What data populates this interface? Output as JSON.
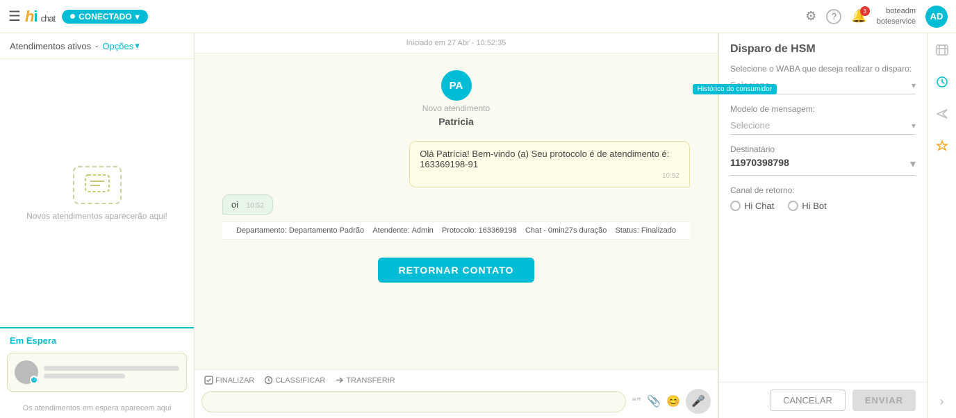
{
  "topnav": {
    "hamburger": "☰",
    "logo": "hi chat",
    "status_label": "CONECTADO",
    "status_arrow": "▾",
    "gear_icon": "⚙",
    "question_icon": "?",
    "bell_icon": "🔔",
    "notification_count": "3",
    "user_name": "boteadm",
    "user_service": "boteservice",
    "avatar_label": "AD"
  },
  "sidebar": {
    "header_label": "Atendimentos ativos",
    "dash": "-",
    "options_label": "Opções",
    "options_arrow": "▾",
    "empty_icon": "💬",
    "empty_text": "Novos atendimentos aparecerão aqui!",
    "waiting_label": "Em Espera",
    "waiting_empty_text": "Os atendimentos em espera aparecem aqui"
  },
  "chat": {
    "header_timestamp": "Iniciado em 27 Abr - 10:52:35",
    "avatar_label": "PA",
    "new_attendance_label": "Novo atendimento",
    "contact_name": "Patricia",
    "bubble_text": "Olá Patrícia! Bem-vindo (a) Seu protocolo é de atendimento é: 163369198-91",
    "bubble_time": "10:52",
    "left_bubble_text": "oi",
    "left_bubble_time": "10:52",
    "info_departamento_label": "Departamento:",
    "info_departamento_value": "Departamento Padrão",
    "info_atendente_label": "Atendente:",
    "info_atendente_value": "Admin",
    "info_protocolo_label": "Protocolo:",
    "info_protocolo_value": "163369198",
    "info_chat_label": "Chat -",
    "info_chat_value": "0min27s duração",
    "info_status_label": "Status:",
    "info_status_value": "Finalizado",
    "retornar_btn": "RETORNAR CONTATO",
    "action_finalizar": "FINALIZAR",
    "action_classificar": "CLASSIFICAR",
    "action_transferir": "TRANSFERIR",
    "input_placeholder": ""
  },
  "right_panel": {
    "title": "Disparo de HSM",
    "waba_label": "Selecione o WABA que deseja realizar o disparo:",
    "waba_select_text": "Selecione",
    "tooltip_text": "Histórico do consumidor",
    "modelo_label": "Modelo de mensagem:",
    "modelo_select_text": "Selecione",
    "destinatario_label": "Destinatário",
    "destinatario_value": "11970398798",
    "canal_label": "Canal de retorno:",
    "radio_hi_chat_label": "Hi Chat",
    "radio_hi_bot_label": "Hi Bot",
    "btn_cancel": "CANCELAR",
    "btn_send": "ENVIAR"
  },
  "icon_strip": {
    "contacts_icon": "👤",
    "history_icon": "🕐",
    "send_icon": "➤",
    "star_icon": "★",
    "chevron_icon": "›"
  }
}
